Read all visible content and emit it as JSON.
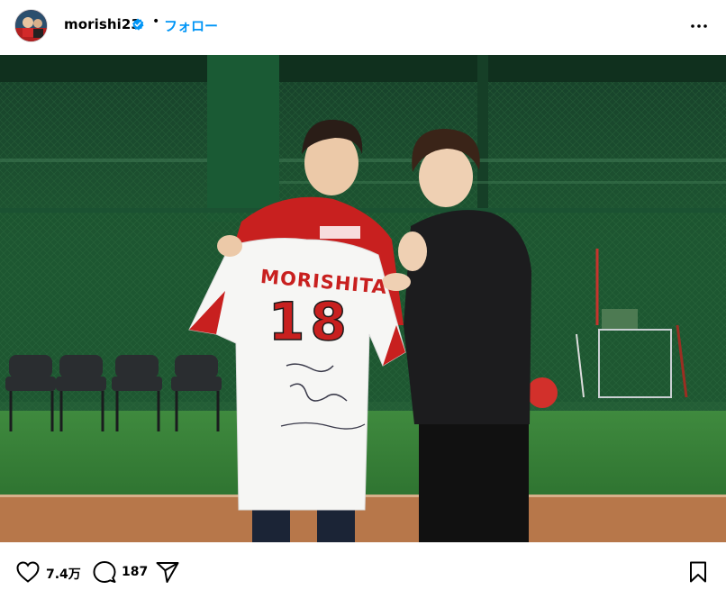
{
  "post": {
    "username": "morishi23",
    "follow_label": "フォロー",
    "dot": "•",
    "likes": "7.4万",
    "comments": "187"
  },
  "photo": {
    "jersey_name": "MORISHITA",
    "jersey_number": "18"
  },
  "colors": {
    "follow": "#0095f6",
    "verified": "#0095f6",
    "jersey_red": "#c8201f",
    "net_green": "#1f5a33",
    "turf": "#3f8a3e"
  },
  "icons": [
    "verified-badge-icon",
    "more-options-icon",
    "heart-icon",
    "comment-icon",
    "share-icon",
    "bookmark-icon"
  ]
}
